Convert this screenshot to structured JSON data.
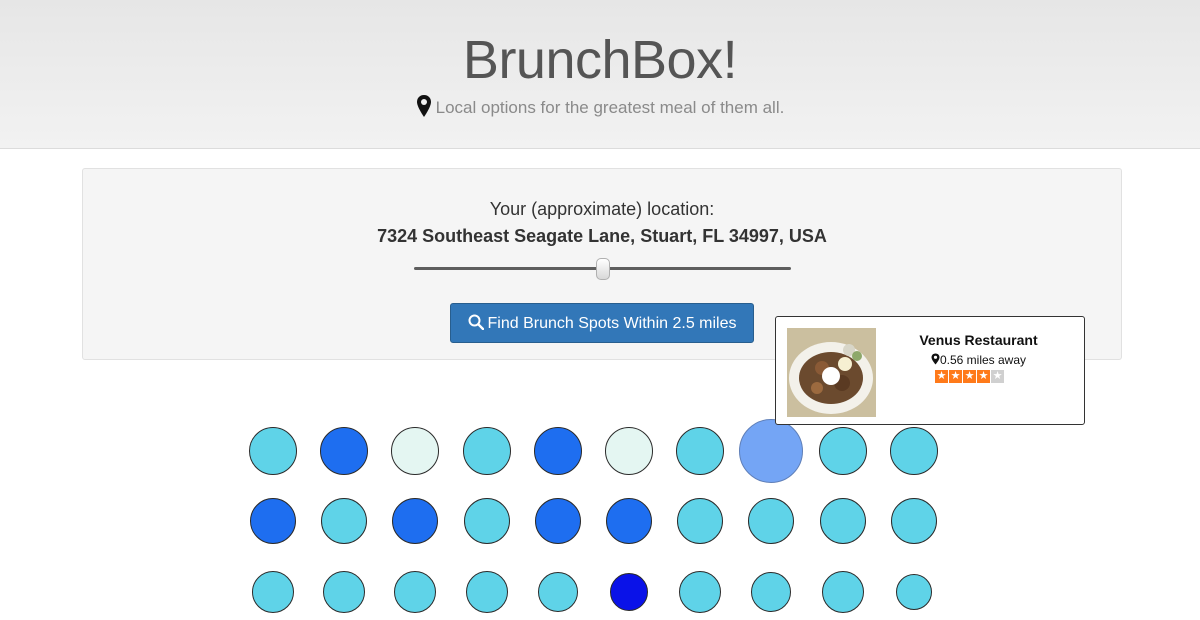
{
  "header": {
    "title": "BrunchBox!",
    "tagline": "Local options for the greatest meal of them all."
  },
  "search": {
    "location_label": "Your (approximate) location:",
    "address": "7324 Southeast Seagate Lane, Stuart, FL 34997, USA",
    "radius_slider_fraction": 0.5,
    "button_label": "Find Brunch Spots Within 2.5 miles",
    "button_icon": "search-icon"
  },
  "popup": {
    "name": "Venus Restaurant",
    "distance": "0.56 miles away",
    "rating_stars": 4,
    "rating_max": 5,
    "image_icon": "food-photo"
  },
  "colors": {
    "primary_button": "#3277b8",
    "star_on": "#ff7a1a",
    "star_off": "#d0d0d0",
    "bubble_light": "#5fd3e8",
    "bubble_mid": "#1e6ef0",
    "bubble_pale": "#e4f6f2",
    "bubble_highlight": "#74a5f5",
    "bubble_dark": "#0a12e8"
  },
  "results": [
    [
      "bubble_light",
      "bubble_mid",
      "bubble_pale",
      "bubble_light",
      "bubble_mid",
      "bubble_pale",
      "bubble_light",
      "bubble_highlight",
      "bubble_light",
      "bubble_light"
    ],
    [
      "bubble_mid",
      "bubble_light",
      "bubble_mid",
      "bubble_light",
      "bubble_mid",
      "bubble_mid",
      "bubble_light",
      "bubble_light",
      "bubble_light",
      "bubble_light"
    ],
    [
      "bubble_light",
      "bubble_light",
      "bubble_light",
      "bubble_light",
      "bubble_light",
      "bubble_dark",
      "bubble_light",
      "bubble_light",
      "bubble_light",
      "bubble_light"
    ]
  ]
}
